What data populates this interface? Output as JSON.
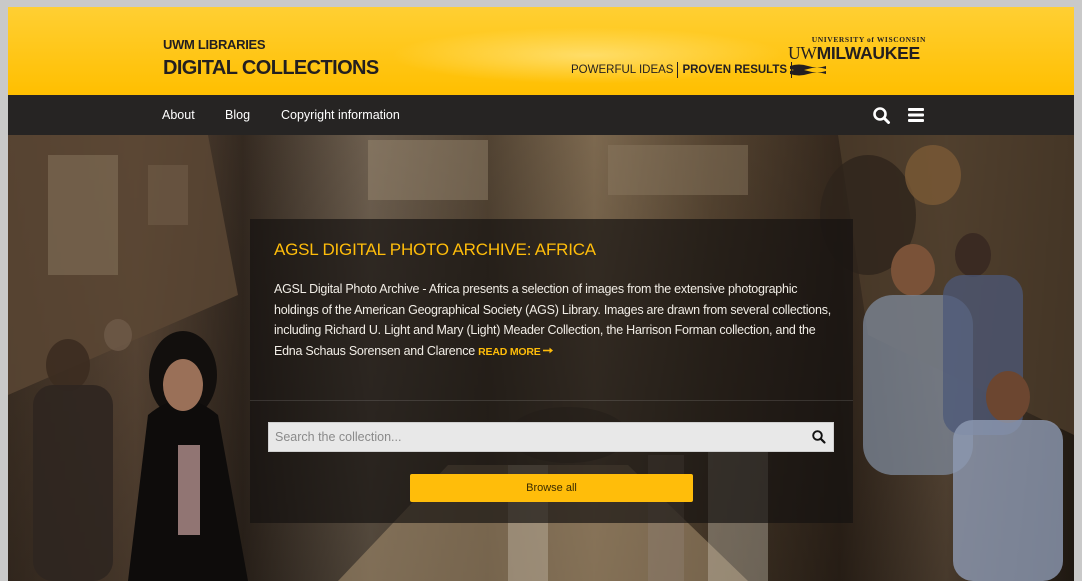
{
  "header": {
    "brand_sub": "UWM LIBRARIES",
    "brand_main": "DIGITAL COLLECTIONS",
    "tagline_left": "POWERFUL IDEAS",
    "tagline_right": "PROVEN RESULTS",
    "university_top": "UNIVERSITY of WISCONSIN",
    "university_uw": "UW",
    "university_main": "MILWAUKEE",
    "accent_color": "#ffbf00"
  },
  "nav": {
    "items": [
      {
        "label": "About"
      },
      {
        "label": "Blog"
      },
      {
        "label": "Copyright information"
      }
    ],
    "search_icon": "search-icon",
    "menu_icon": "hamburger-menu-icon"
  },
  "collection": {
    "title": "AGSL DIGITAL PHOTO ARCHIVE: AFRICA",
    "description": "AGSL Digital Photo Archive - Africa presents a selection of images from the extensive photographic holdings of the American Geographical Society (AGS) Library. Images are drawn from several collections, including Richard U. Light and Mary (Light) Meader Collection, the Harrison Forman collection, and the Edna Schaus Sorensen and Clarence",
    "read_more": "READ MORE",
    "read_more_icon": "arrow-right-icon",
    "title_color": "#ffbd0a"
  },
  "search": {
    "placeholder": "Search the collection...",
    "value": "",
    "button_icon": "search-icon"
  },
  "browse": {
    "label": "Browse all"
  }
}
